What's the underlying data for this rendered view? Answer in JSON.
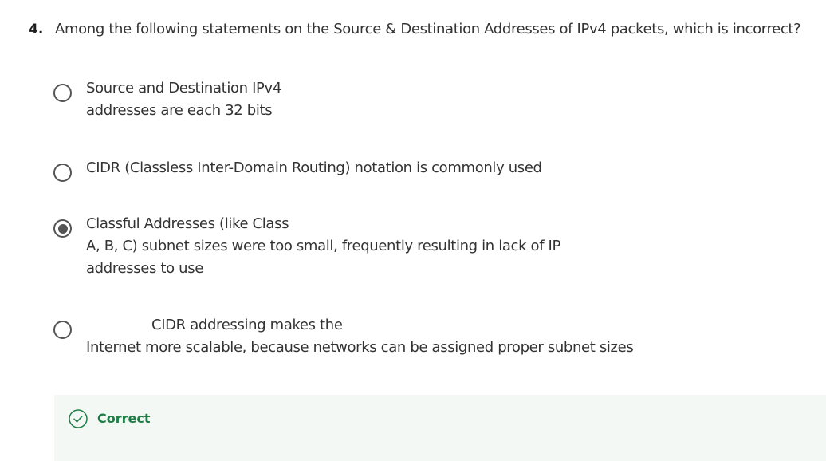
{
  "question": {
    "number": "4.",
    "text": "Among the following statements on the Source & Destination Addresses of IPv4 packets, which is incorrect?"
  },
  "options": [
    {
      "lines": [
        "Source and Destination IPv4",
        "addresses are each 32 bits"
      ],
      "selected": false
    },
    {
      "lines": [
        "CIDR (Classless Inter-Domain Routing) notation is commonly used"
      ],
      "selected": false
    },
    {
      "lines": [
        "Classful Addresses (like Class",
        "A, B, C) subnet sizes were too small, frequently resulting in lack of IP",
        "addresses to use"
      ],
      "selected": true
    },
    {
      "lines": [
        "CIDR addressing makes the",
        "Internet more scalable, because networks can be assigned proper subnet sizes"
      ],
      "selected": false
    }
  ],
  "feedback": {
    "label": "Correct",
    "icon": "check-circle-icon",
    "color": "#1e7e45",
    "background": "#f4f8f5"
  }
}
